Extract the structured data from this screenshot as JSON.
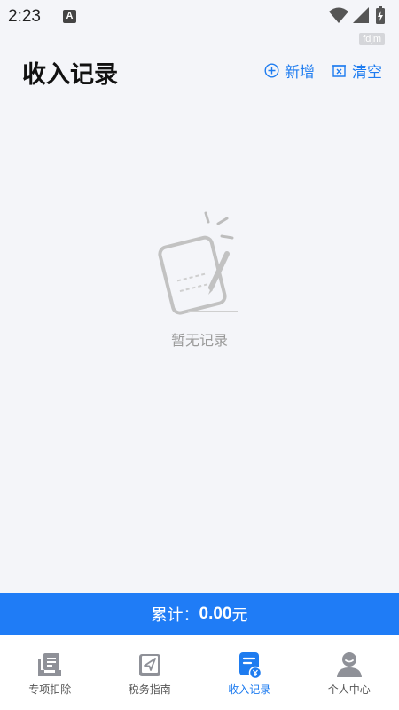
{
  "status_bar": {
    "time": "2:23",
    "notification_letter": "A",
    "icons": [
      "wifi-icon",
      "signal-icon",
      "battery-charging-icon"
    ]
  },
  "watermark": "fdjm",
  "header": {
    "title": "收入记录",
    "add_label": "新增",
    "clear_label": "清空"
  },
  "empty_state": {
    "text": "暂无记录",
    "icon": "empty-notebook-pencil-icon"
  },
  "total": {
    "label": "累计：",
    "value": "0.00",
    "unit": "元"
  },
  "tabs": [
    {
      "label": "专项扣除",
      "icon": "deduction-inbox-icon",
      "active": false
    },
    {
      "label": "税务指南",
      "icon": "guide-book-icon",
      "active": false
    },
    {
      "label": "收入记录",
      "icon": "income-record-icon",
      "active": true
    },
    {
      "label": "个人中心",
      "icon": "user-profile-icon",
      "active": false
    }
  ],
  "colors": {
    "accent": "#1e7cf0",
    "total_bar": "#1f7cf6",
    "background": "#f4f5f9",
    "inactive_icon": "#8f9198"
  }
}
